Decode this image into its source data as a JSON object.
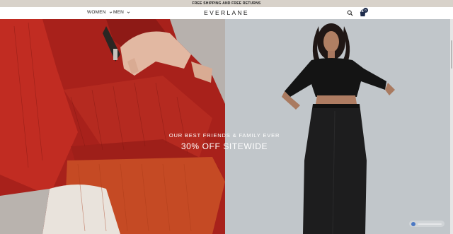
{
  "promo": {
    "text": "FREE SHIPPING AND FREE RETURNS"
  },
  "header": {
    "logo": "EVERLANE",
    "nav": [
      {
        "label": "WOMEN",
        "icon": "chevron-down-icon"
      },
      {
        "label": "MEN",
        "icon": "chevron-down-icon"
      }
    ],
    "search_icon": "search-icon",
    "cart_icon": "shopping-bag-icon",
    "cart_count": "0"
  },
  "hero": {
    "eyebrow": "OUR BEST FRIENDS & FAMILY EVER",
    "headline": "30% OFF SITEWIDE",
    "left_image": "model-in-red-knit-sweater",
    "right_image": "model-in-black-top-and-trousers"
  },
  "colors": {
    "promo_bg": "#d8d2ca",
    "sweater_red": "#b3261e",
    "sweater_orange": "#c9481e",
    "cart_badge": "#1e2c4c"
  }
}
